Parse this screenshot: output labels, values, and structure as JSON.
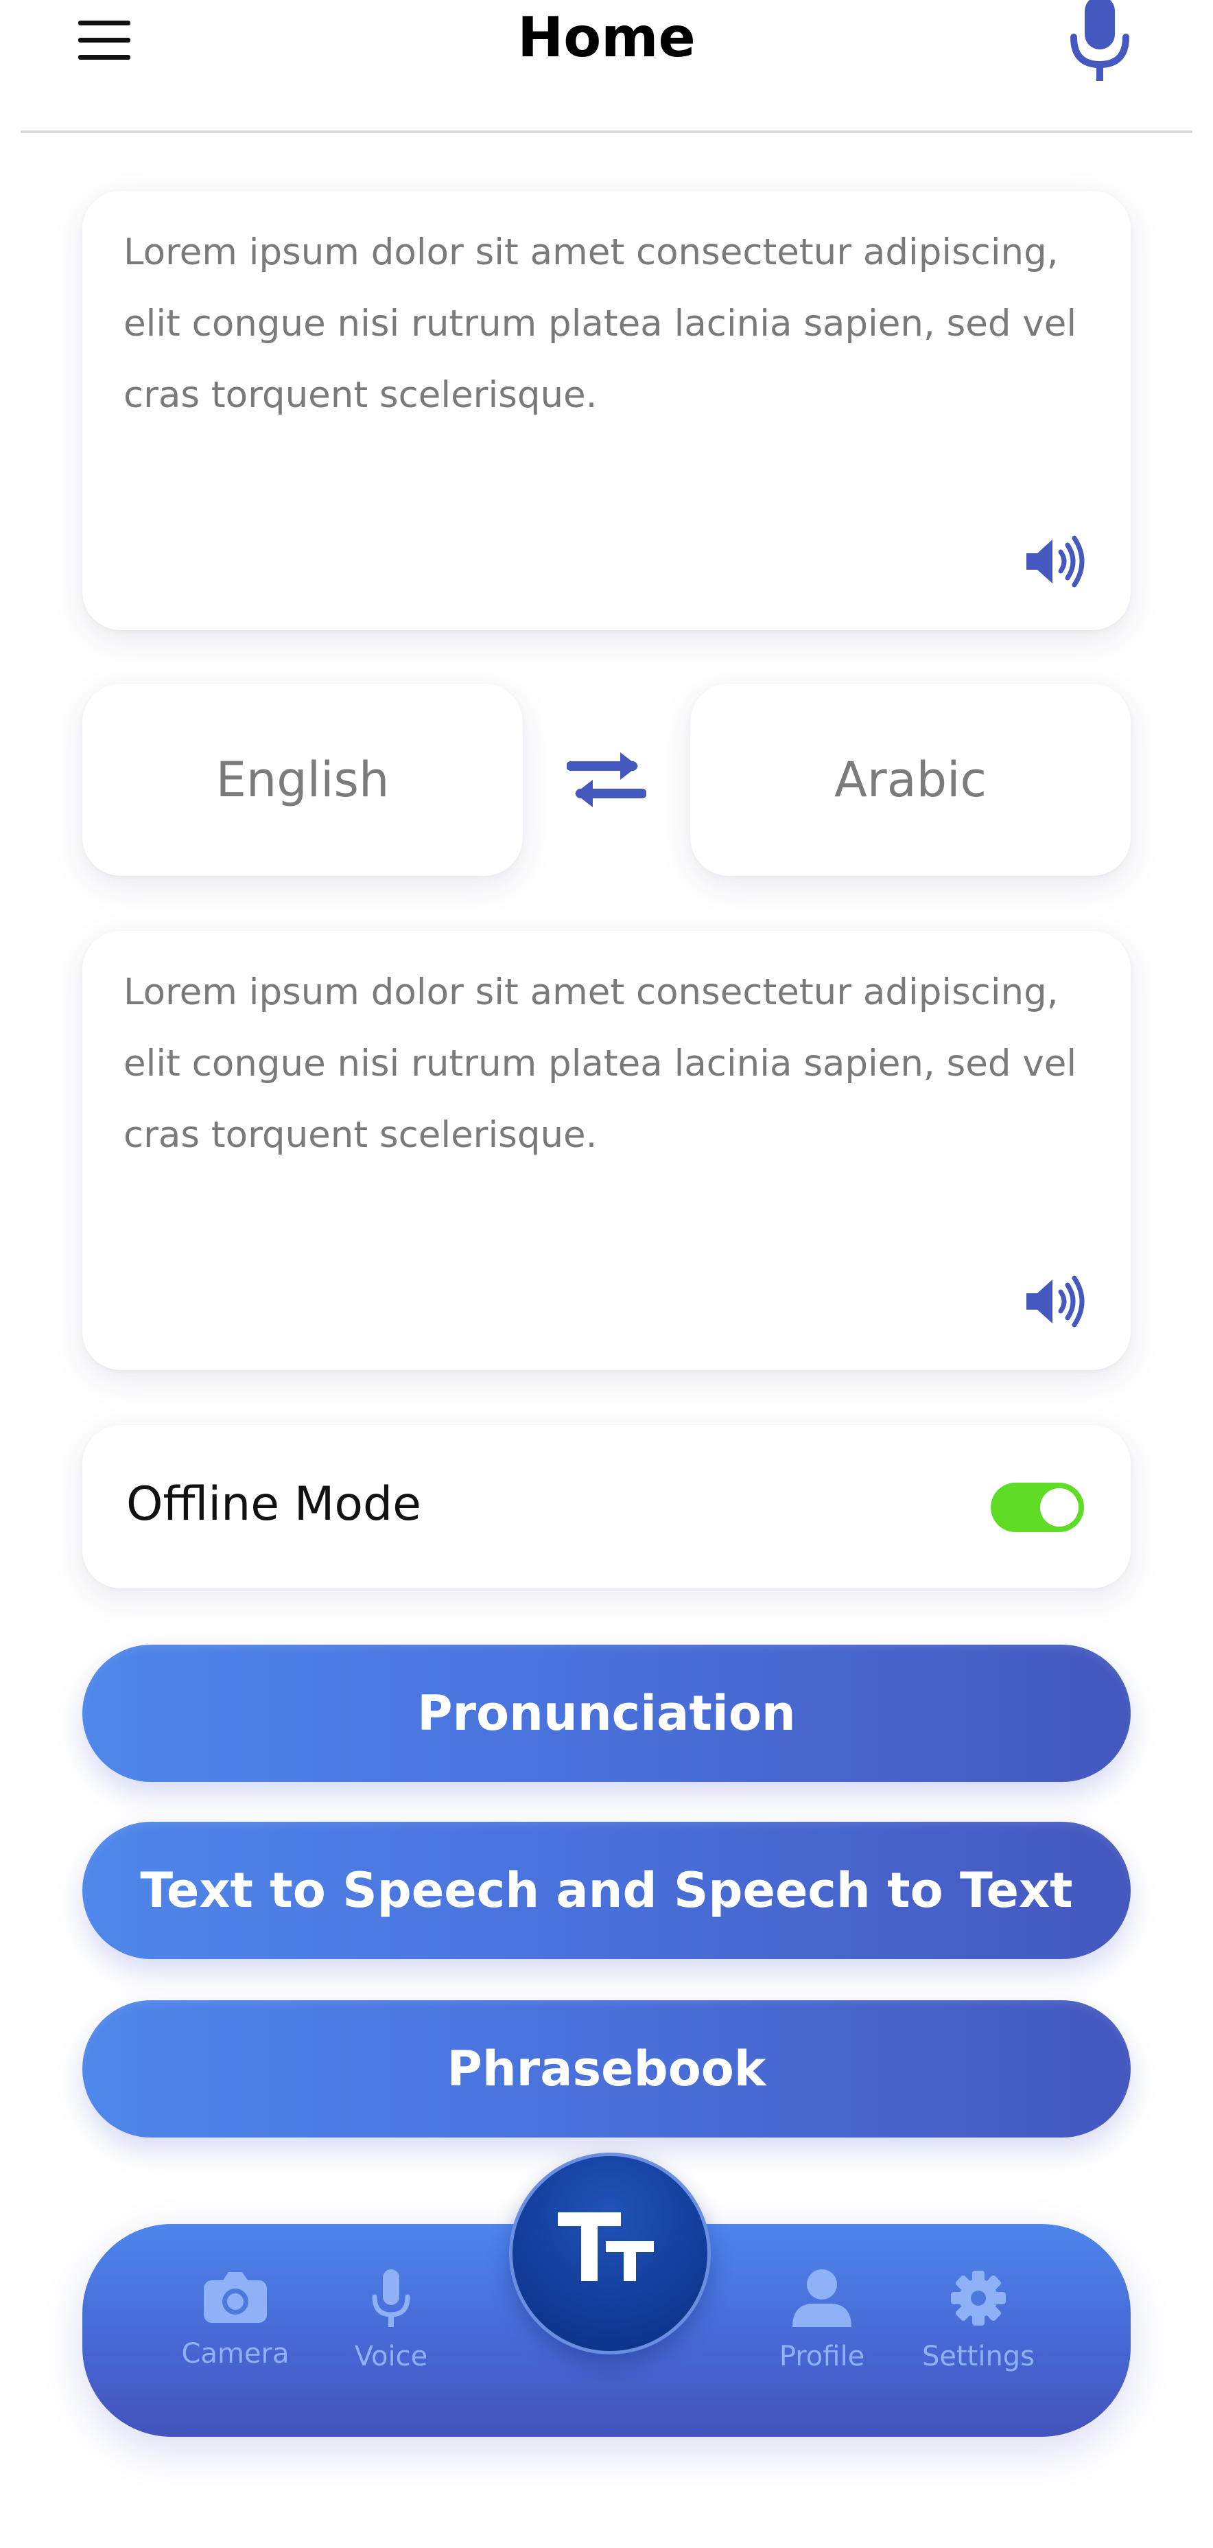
{
  "header": {
    "title": "Home",
    "menu_icon": "hamburger-menu-icon",
    "mic_icon": "microphone-icon"
  },
  "source_card": {
    "text": "Lorem ipsum dolor sit amet consectetur adipiscing, elit congue nisi rutrum platea lacinia sapien, sed vel cras torquent scelerisque.",
    "speaker_icon": "speaker-icon"
  },
  "languages": {
    "source": "English",
    "target": "Arabic",
    "swap_icon": "swap-arrows-icon"
  },
  "target_card": {
    "text": "Lorem ipsum dolor sit amet consectetur adipiscing, elit congue nisi rutrum platea lacinia sapien, sed vel cras torquent scelerisque.",
    "speaker_icon": "speaker-icon"
  },
  "offline": {
    "label": "Offline Mode",
    "enabled": true
  },
  "buttons": {
    "pronunciation": "Pronunciation",
    "tts_stt": "Text to Speech and Speech to Text",
    "phrasebook": "Phrasebook"
  },
  "nav": {
    "camera": "Camera",
    "voice": "Voice",
    "profile": "Profile",
    "settings": "Settings",
    "center_icon": "text-size-icon"
  },
  "colors": {
    "accent": "#4458bf",
    "toggle_on": "#5fdc25",
    "fab": "#123e9c"
  }
}
